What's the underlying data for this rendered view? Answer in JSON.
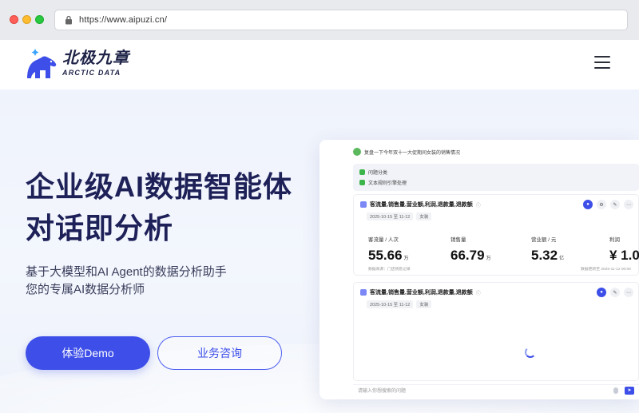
{
  "browser": {
    "url": "https://www.aipuzi.cn/"
  },
  "nav": {
    "logo_cn": "北极九章",
    "logo_en": "ARCTIC DATA",
    "menu_icon": "hamburger-menu-icon"
  },
  "hero": {
    "title_line1": "企业级AI数据智能体",
    "title_line2": "对话即分析",
    "subtitle_line1": "基于大模型和AI Agent的数据分析助手",
    "subtitle_line2": "您的专属AI数据分析师",
    "cta_primary": "体验Demo",
    "cta_secondary": "业务咨询"
  },
  "colors": {
    "accent": "#3d4fe8",
    "title": "#1e2158"
  },
  "demo": {
    "question": "复盘一下今年双十一大促期间女装的销售情况",
    "steps": [
      "问题分类",
      "文本规则引擎处理"
    ],
    "card1": {
      "title": "客流量,销售量,营业额,利润,退款量,退款额",
      "date": "2025-10-15 至 11-12",
      "tag": "女装",
      "metrics": [
        {
          "label": "客流量 / 人次",
          "value": "55.66",
          "unit": "万"
        },
        {
          "label": "销售量",
          "value": "66.79",
          "unit": "万"
        },
        {
          "label": "营业额 / 元",
          "value": "5.32",
          "unit": "亿"
        },
        {
          "label": "利润",
          "value": "¥ 1.0",
          "unit": ""
        }
      ],
      "source": "数据来源：门店销售记录",
      "updated": "数据更新至 2025-11-12 00:00"
    },
    "card2": {
      "title": "客流量,销售量,营业额,利润,退款量,退款额",
      "date": "2025-10-15 至 11-12",
      "tag": "女装"
    },
    "input_placeholder": "请输入你想搜索的问题"
  }
}
